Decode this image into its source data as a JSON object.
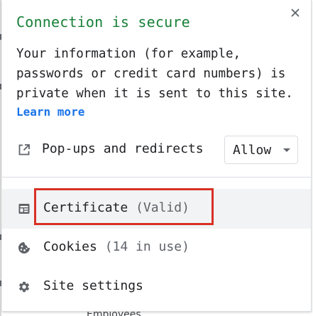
{
  "popup": {
    "title": "Connection is secure",
    "description_lines": [
      "Your information (for example,",
      "passwords or credit card numbers) is",
      "private when it is sent to this site."
    ],
    "learn_more": "Learn more",
    "close_icon": "close-icon"
  },
  "permissions": [
    {
      "label": "Pop-ups and redirects",
      "icon": "open-in-new-icon",
      "value": "Allow"
    }
  ],
  "menu": {
    "certificate": {
      "label": "Certificate",
      "status": "(Valid)",
      "icon": "certificate-icon"
    },
    "cookies": {
      "label": "Cookies",
      "status": "(14 in use)",
      "icon": "cookie-icon"
    },
    "site_settings": {
      "label": "Site settings",
      "icon": "gear-icon"
    }
  },
  "colors": {
    "secure_green": "#188038",
    "link_blue": "#1a73e8",
    "highlight_red": "#d93025",
    "hover_gray": "#f1f3f4"
  },
  "backdrop": {
    "peek_text": "Employees"
  }
}
